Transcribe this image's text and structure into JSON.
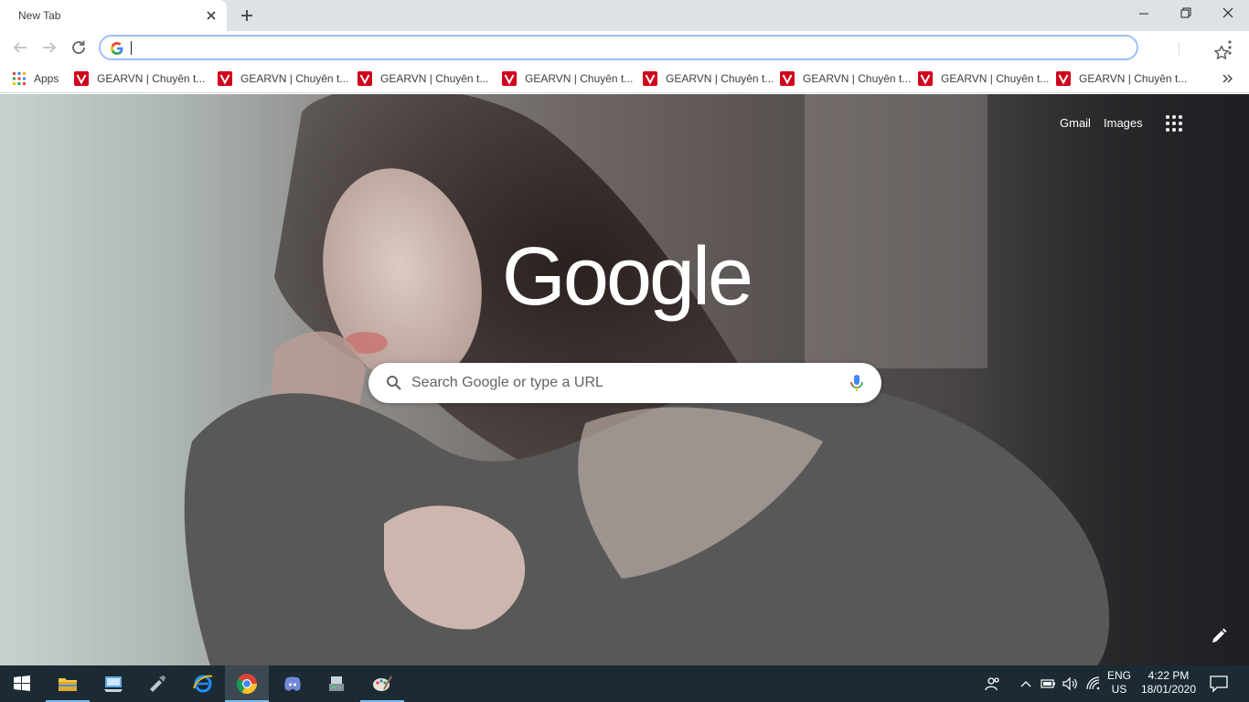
{
  "window": {
    "tab_title": "New Tab"
  },
  "omnibox": {
    "value": ""
  },
  "bookmarks": {
    "apps_label": "Apps",
    "items": [
      "GEARVN | Chuyên t...",
      "GEARVN | Chuyên t...",
      "GEARVN | Chuyên t...",
      "GEARVN | Chuyên t...",
      "GEARVN | Chuyên t...",
      "GEARVN | Chuyên t...",
      "GEARVN | Chuyên t...",
      "GEARVN | Chuyên t..."
    ],
    "overflow_label": "»"
  },
  "ntp": {
    "gmail_label": "Gmail",
    "images_label": "Images",
    "logo_text": "Google",
    "search_placeholder": "Search Google or type a URL"
  },
  "taskbar": {
    "lang_line1": "ENG",
    "lang_line2": "US",
    "time": "4:22 PM",
    "date": "18/01/2020"
  },
  "icons": [
    "windows-start-icon",
    "file-explorer-icon",
    "computer-icon",
    "tool-icon",
    "internet-explorer-icon",
    "chrome-icon",
    "discord-icon",
    "network-drive-icon",
    "paint-icon",
    "people-icon",
    "chevron-up-icon",
    "battery-icon",
    "volume-icon",
    "wifi-icon",
    "notification-icon"
  ],
  "colors": {
    "bookmark_favicon": "#d0021b",
    "omnibox_focus": "#9cc0f9",
    "taskbar": "#1b2a33",
    "taskbar_active": "#76b9ed"
  }
}
